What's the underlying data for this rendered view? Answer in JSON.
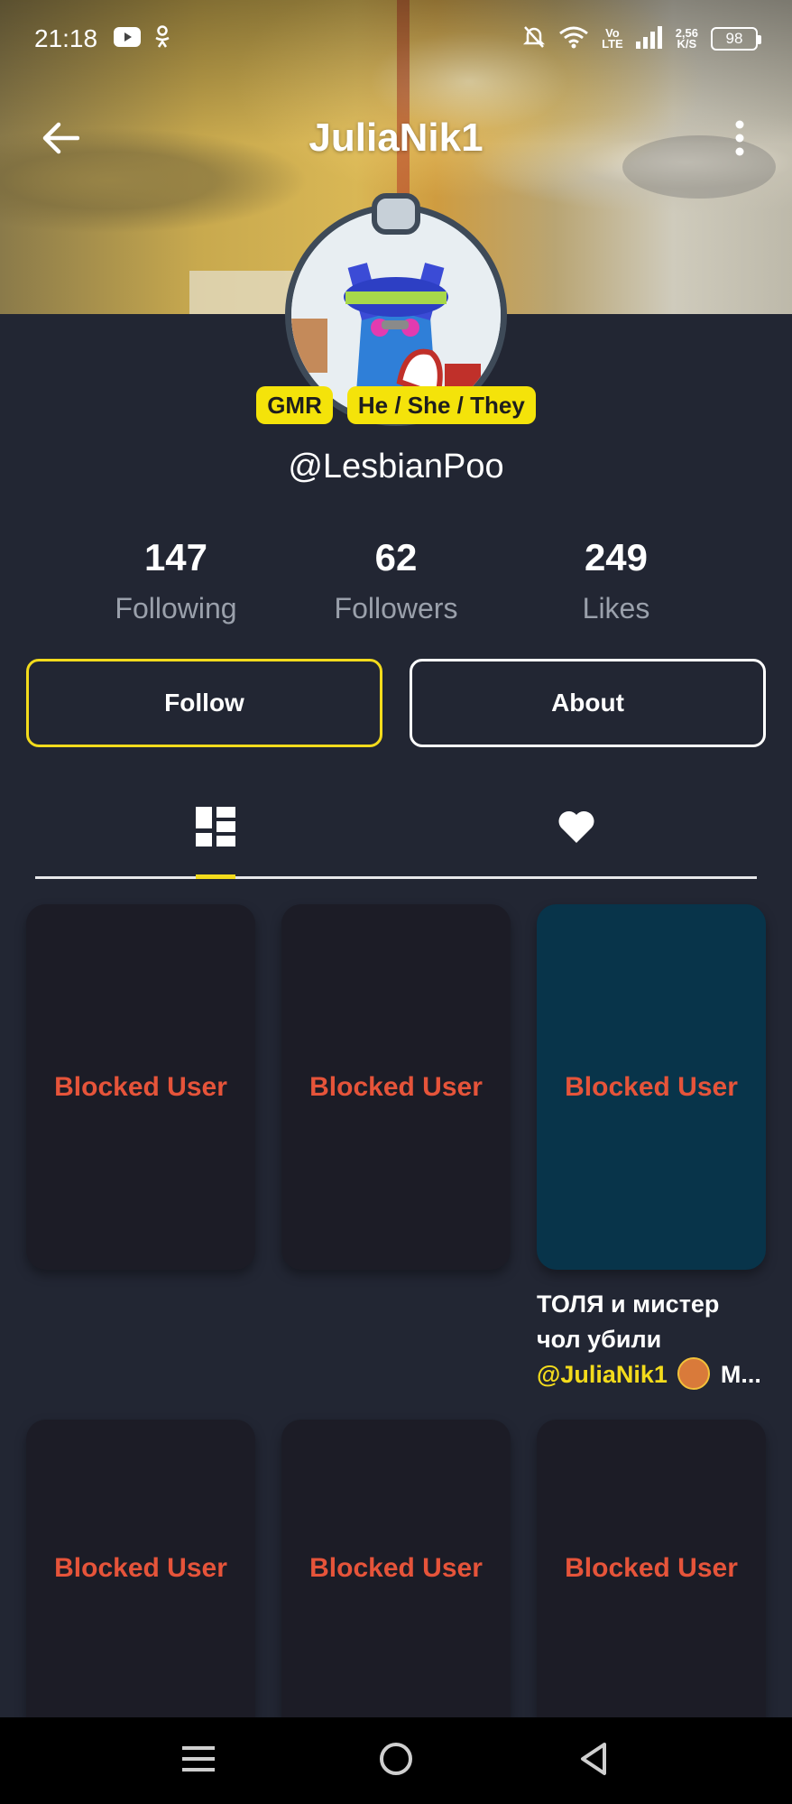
{
  "status_bar": {
    "time": "21:18",
    "left_icons": [
      "youtube-icon",
      "odnoklassniki-icon"
    ],
    "right_icons": [
      "bell-off-icon",
      "wifi-icon",
      "volte-icon",
      "signal-icon"
    ],
    "volte_top": "Vo",
    "volte_bottom": "LTE",
    "speed_value": "2,56",
    "speed_unit": "K/S",
    "battery": "98"
  },
  "header": {
    "title": "JuliaNik1",
    "back_icon": "arrow-left-icon",
    "more_icon": "more-vertical-icon"
  },
  "profile": {
    "badges": [
      "GMR",
      "He / She / They"
    ],
    "handle": "@LesbianPoo"
  },
  "stats": [
    {
      "value": "147",
      "label": "Following"
    },
    {
      "value": "62",
      "label": "Followers"
    },
    {
      "value": "249",
      "label": "Likes"
    }
  ],
  "actions": {
    "follow_label": "Follow",
    "about_label": "About",
    "follow_border": "#f3db1c",
    "about_border": "#ffffff"
  },
  "tabs": [
    {
      "icon": "grid-icon",
      "active": true
    },
    {
      "icon": "heart-icon",
      "active": false
    }
  ],
  "grid": {
    "items": [
      {
        "label": "Blocked User",
        "bg": "#1c1c26"
      },
      {
        "label": "Blocked User",
        "bg": "#1c1c26"
      },
      {
        "label": "Blocked User",
        "bg": "#08344a"
      },
      {
        "label": "Blocked User",
        "bg": "#1c1c26"
      },
      {
        "label": "Blocked User",
        "bg": "#1c1c26"
      },
      {
        "label": "Blocked User",
        "bg": "#1c1c26"
      }
    ],
    "caption_line1": "ТОЛЯ и мистер",
    "caption_line2": "чол убили",
    "caption_mention": "@JuliaNik1",
    "caption_tail": "M..."
  },
  "nav_bar": {
    "icons": [
      "menu-icon",
      "home-circle-icon",
      "back-triangle-icon"
    ]
  },
  "colors": {
    "background": "#222633",
    "accent": "#f3db1c",
    "blocked_text": "#e6543a"
  }
}
